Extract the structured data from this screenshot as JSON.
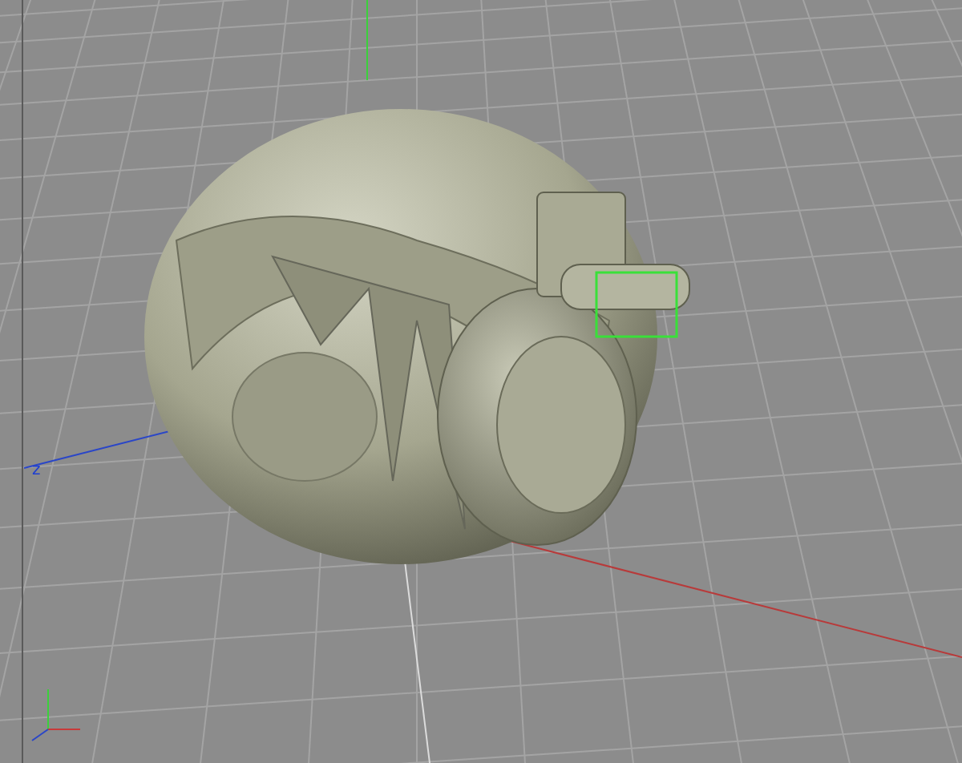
{
  "viewport": {
    "axis_label": "z"
  }
}
